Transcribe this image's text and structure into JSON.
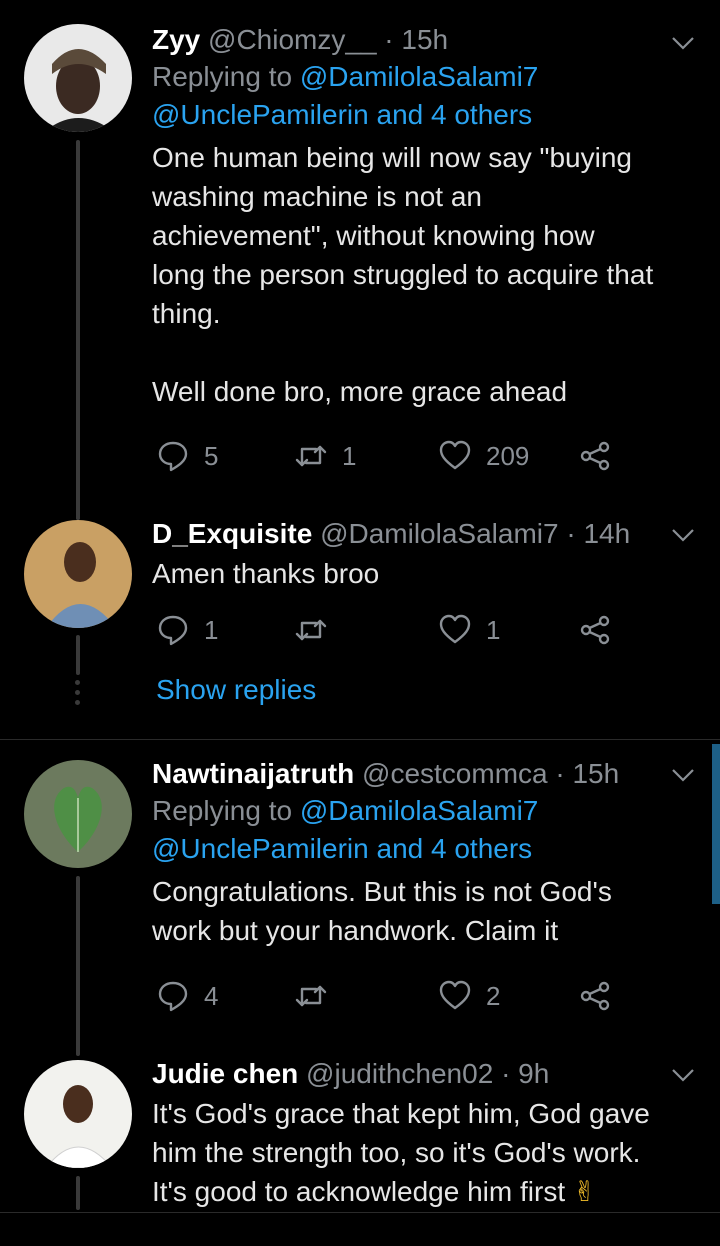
{
  "tweets": [
    {
      "name": "Zyy",
      "handle": "@Chiomzy__",
      "time": "15h",
      "replying_prefix": "Replying to",
      "replying_user": "@DamilolaSalami7",
      "replying_rest": "@UnclePamilerin and 4 others",
      "text": "One human being will now say \"buying\nwashing machine is not an\nachievement\", without knowing how\nlong the person struggled to acquire that\nthing.\n\nWell done bro, more grace ahead",
      "replies": "5",
      "retweets": "1",
      "likes": "209"
    },
    {
      "name": "D_Exquisite",
      "handle": "@DamilolaSalami7",
      "time": "14h",
      "text": "Amen thanks broo",
      "replies": "1",
      "retweets": "",
      "likes": "1"
    },
    {
      "name": "Nawtinaijatruth",
      "handle": "@cestcommca",
      "time": "15h",
      "replying_prefix": "Replying to",
      "replying_user": "@DamilolaSalami7",
      "replying_rest": "@UnclePamilerin and 4 others",
      "text": "Congratulations. But this is not God's\nwork but your handwork. Claim it",
      "replies": "4",
      "retweets": "",
      "likes": "2"
    },
    {
      "name": "Judie chen",
      "handle": "@judithchen02",
      "time": "9h",
      "text": "It's God's grace that kept him, God gave\nhim the strength too, so it's God's work.\nIt's good to acknowledge him first",
      "emoji": "✌"
    }
  ],
  "separator": "·",
  "show_replies": "Show replies",
  "colors": {
    "background": "#000000",
    "accent": "#2aa3f0",
    "muted": "#8a8f95"
  },
  "icons": [
    "reply-icon",
    "retweet-icon",
    "like-icon",
    "share-icon",
    "chevron-down-icon"
  ]
}
